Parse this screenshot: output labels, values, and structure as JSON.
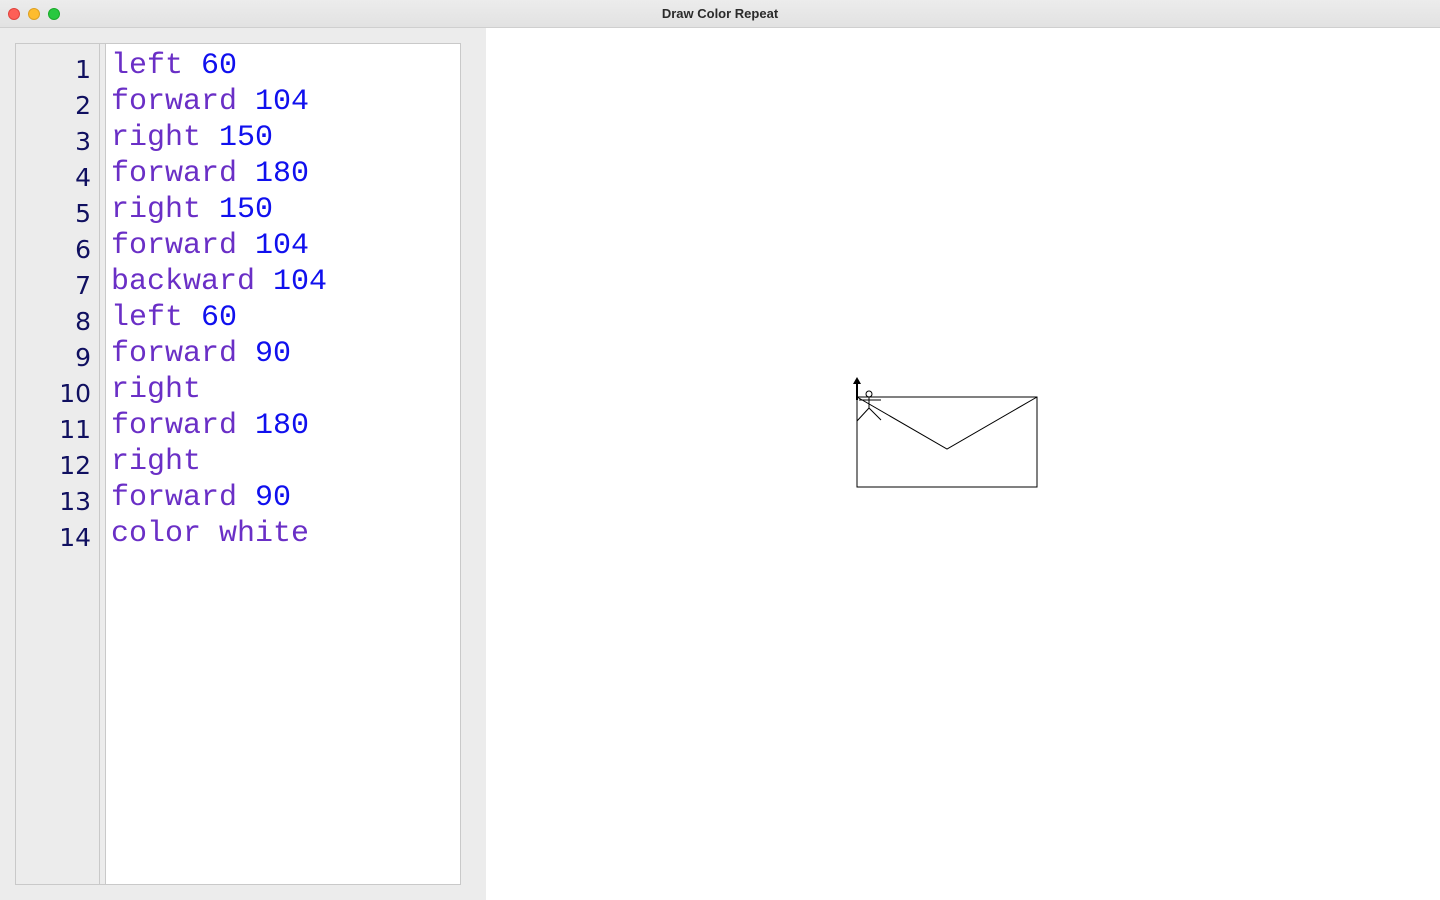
{
  "window": {
    "title": "Draw Color Repeat"
  },
  "editor": {
    "lines": [
      {
        "num": "1",
        "cmd": "left",
        "arg": "60"
      },
      {
        "num": "2",
        "cmd": "forward",
        "arg": "104"
      },
      {
        "num": "3",
        "cmd": "right",
        "arg": "150"
      },
      {
        "num": "4",
        "cmd": "forward",
        "arg": "180"
      },
      {
        "num": "5",
        "cmd": "right",
        "arg": "150"
      },
      {
        "num": "6",
        "cmd": "forward",
        "arg": "104"
      },
      {
        "num": "7",
        "cmd": "backward",
        "arg": "104"
      },
      {
        "num": "8",
        "cmd": "left",
        "arg": "60"
      },
      {
        "num": "9",
        "cmd": "forward",
        "arg": "90"
      },
      {
        "num": "10",
        "cmd": "right",
        "arg": ""
      },
      {
        "num": "11",
        "cmd": "forward",
        "arg": "180"
      },
      {
        "num": "12",
        "cmd": "right",
        "arg": ""
      },
      {
        "num": "13",
        "cmd": "forward",
        "arg": "90"
      },
      {
        "num": "14",
        "cmd": "color",
        "arg": "white"
      }
    ]
  },
  "colors": {
    "keyword": "#6a2fc6",
    "number": "#1010ee",
    "line_number": "#101060",
    "drawing_stroke": "#000000"
  },
  "canvas": {
    "icon": "stick-figure-turtle-icon"
  }
}
